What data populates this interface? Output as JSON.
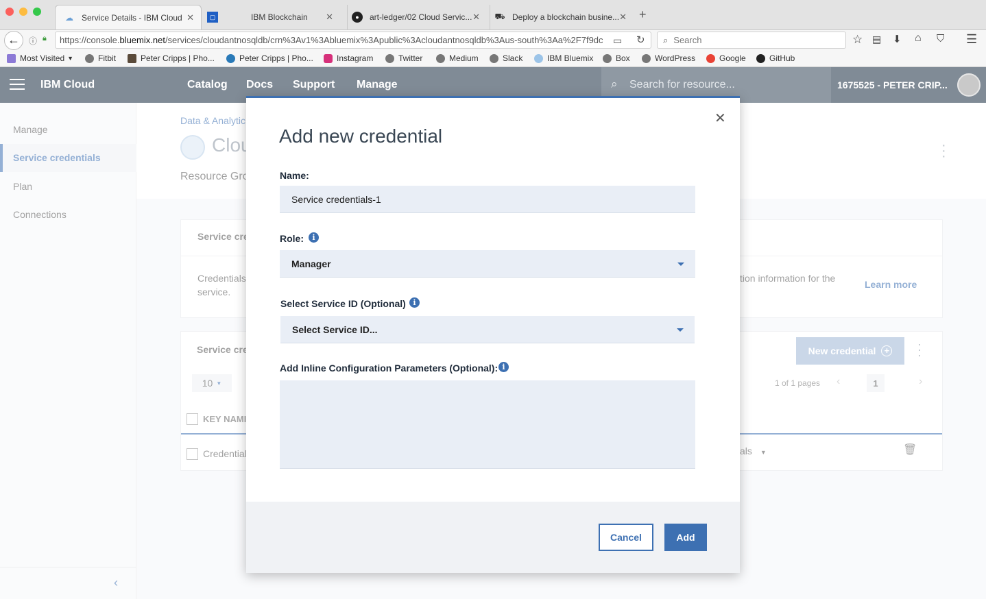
{
  "browser": {
    "tabs": [
      {
        "title": "Service Details - IBM Cloud",
        "icon": "cloud-icon"
      },
      {
        "title": "IBM Blockchain",
        "icon": "blockchain-icon"
      },
      {
        "title": "art-ledger/02 Cloud Servic...",
        "icon": "github-icon"
      },
      {
        "title": "Deploy a blockchain busine...",
        "icon": "deploy-icon"
      }
    ],
    "url_prefix": "https://console.",
    "url_domain": "bluemix.net",
    "url_rest": "/services/cloudantnosqldb/crn%3Av1%3Abluemix%3Apublic%3Acloudantnosqldb%3Aus-south%3Aa%2F7f9dc",
    "search_placeholder": "Search",
    "bookmarks": [
      "Most Visited",
      "Fitbit",
      "Peter Cripps | Pho...",
      "Peter Cripps | Pho...",
      "Instagram",
      "Twitter",
      "Medium",
      "Slack",
      "IBM Bluemix",
      "Box",
      "WordPress",
      "Google",
      "GitHub"
    ]
  },
  "header": {
    "brand": "IBM Cloud",
    "nav": [
      "Catalog",
      "Docs",
      "Support",
      "Manage"
    ],
    "search_placeholder": "Search for resource...",
    "account": "1675525 - PETER CRIP..."
  },
  "sidebar": {
    "items": [
      "Manage",
      "Service credentials",
      "Plan",
      "Connections"
    ],
    "active": "Service credentials"
  },
  "page": {
    "breadcrumb": "Data & Analytic",
    "title": "Clou",
    "resource_group": "Resource Gro",
    "panel1_title": "Service cre",
    "panel1_text_a": "Credentials",
    "panel1_text_b": "service.",
    "panel1_text_right": "tion information for the",
    "learn_more": "Learn more",
    "panel2_title": "Service cre",
    "new_credential": "New credential",
    "per_page": "10",
    "pages_text": "1 of 1 pages",
    "page_num": "1",
    "col_key_name": "KEY NAMI",
    "row_name": "Credential",
    "row_action": "als"
  },
  "modal": {
    "title": "Add new credential",
    "name_label": "Name:",
    "name_value": "Service credentials-1",
    "role_label": "Role:",
    "role_value": "Manager",
    "service_id_label": "Select Service ID (Optional)",
    "service_id_value": "Select Service ID...",
    "params_label": "Add Inline Configuration Parameters (Optional):",
    "params_value": "",
    "cancel": "Cancel",
    "add": "Add"
  },
  "colors": {
    "accent": "#3d70b2",
    "header": "#808b96",
    "field": "#e9eef6"
  }
}
